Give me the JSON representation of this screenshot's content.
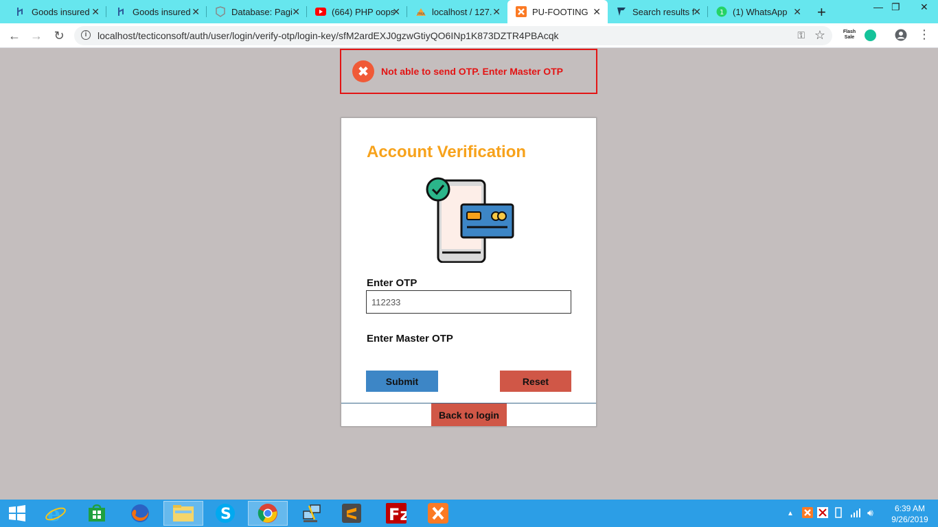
{
  "browser": {
    "tabs": [
      {
        "title": "Goods insured",
        "icon": "laravel-icon"
      },
      {
        "title": "Goods insured",
        "icon": "laravel-icon"
      },
      {
        "title": "Database: Pagi",
        "icon": "laravel-icon"
      },
      {
        "title": "(664) PHP oops",
        "icon": "youtube-icon"
      },
      {
        "title": "localhost / 127.",
        "icon": "phpmyadmin-icon"
      },
      {
        "title": "PU-FOOTING",
        "icon": "xampp-icon"
      },
      {
        "title": "Search results f",
        "icon": "search-results-icon"
      },
      {
        "title": "(1) WhatsApp",
        "icon": "whatsapp-icon"
      }
    ],
    "active_tab_index": 5,
    "url": "localhost/tecticonsoft/auth/user/login/verify-otp/login-key/sfM2ardEXJ0gzwGtiyQO6INp1K873DZTR4PBAcqk",
    "extension_label": "Flash Sale"
  },
  "alert": {
    "message": "Not able to send OTP. Enter Master OTP",
    "color": "#e31414"
  },
  "card": {
    "title": "Account Verification",
    "otp_label": "Enter OTP",
    "otp_value": "112233",
    "master_otp_label": "Enter Master OTP",
    "submit_label": "Submit",
    "reset_label": "Reset",
    "back_label": "Back to login",
    "accent": "#f7a21b",
    "submit_color": "#3d86c6",
    "danger_color": "#d05747"
  },
  "taskbar": {
    "apps": [
      "windows-start-icon",
      "internet-explorer-icon",
      "store-icon",
      "firefox-icon",
      "file-explorer-icon",
      "skype-icon",
      "chrome-icon",
      "network-app-icon",
      "sublime-text-icon",
      "filezilla-icon",
      "xampp-icon"
    ],
    "time": "6:39 AM",
    "date": "9/26/2019"
  }
}
